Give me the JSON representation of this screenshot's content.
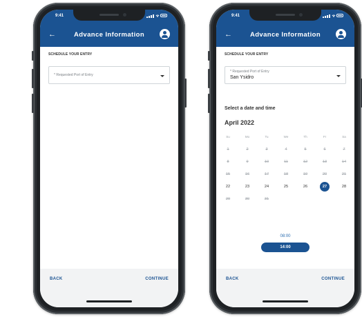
{
  "status": {
    "time": "9:41"
  },
  "header": {
    "title": "Advance Information"
  },
  "section": {
    "label": "SCHEDULE YOUR ENTRY"
  },
  "port_select": {
    "placeholder": "* Requested Port of Entry",
    "value": "San Ysidro"
  },
  "calendar": {
    "heading": "Select a date and time",
    "month": "April 2022",
    "weekdays": [
      "Su",
      "Mo",
      "Tu",
      "We",
      "Th",
      "Fr",
      "Sa"
    ],
    "weeks": [
      [
        "1",
        "2",
        "3",
        "4",
        "5",
        "6",
        "7"
      ],
      [
        "8",
        "9",
        "10",
        "11",
        "12",
        "13",
        "14"
      ],
      [
        "15",
        "16",
        "17",
        "18",
        "19",
        "20",
        "21"
      ],
      [
        "22",
        "23",
        "24",
        "25",
        "26",
        "27",
        "28"
      ],
      [
        "29",
        "30",
        "31",
        "",
        "",
        "",
        ""
      ]
    ],
    "selected_day": "27"
  },
  "times": [
    "08:00",
    "14:00"
  ],
  "selected_time": "14:00",
  "footer": {
    "back": "BACK",
    "continue": "CONTINUE"
  },
  "colors": {
    "brand": "#1b5392",
    "footer_bg": "#f2f3f4"
  }
}
